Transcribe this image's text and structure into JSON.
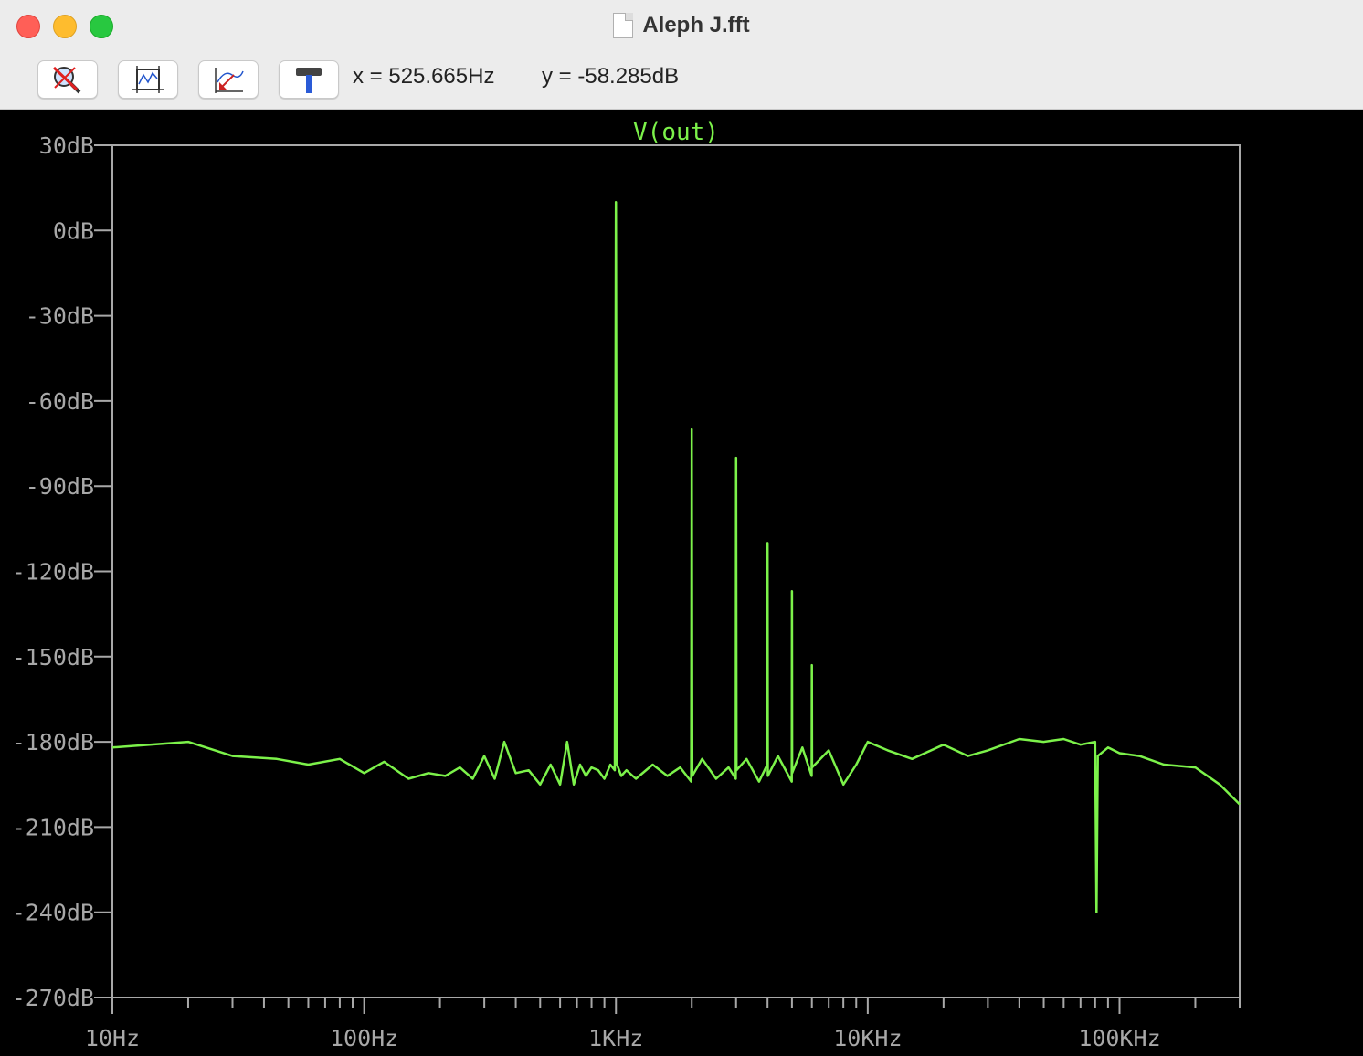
{
  "window": {
    "title": "Aleph J.fft"
  },
  "toolbar": {
    "buttons": [
      {
        "name": "zoom-cancel",
        "icon": "zoom-cancel-icon"
      },
      {
        "name": "autorange",
        "icon": "autorange-icon"
      },
      {
        "name": "pick-trace",
        "icon": "pick-trace-icon"
      },
      {
        "name": "hammer",
        "icon": "hammer-icon"
      }
    ],
    "cursor_x": "x = 525.665Hz",
    "cursor_y": "y = -58.285dB"
  },
  "colors": {
    "trace": "#7cf24a",
    "axis": "#a8a8a8",
    "background": "#000000"
  },
  "chart_data": {
    "type": "line",
    "title": "V(out)",
    "x_scale": "log",
    "xlim": [
      10,
      300000
    ],
    "ylim": [
      -270,
      30
    ],
    "xticks": [
      {
        "value": 10,
        "label": "10Hz"
      },
      {
        "value": 100,
        "label": "100Hz"
      },
      {
        "value": 1000,
        "label": "1KHz"
      },
      {
        "value": 10000,
        "label": "10KHz"
      },
      {
        "value": 100000,
        "label": "100KHz"
      }
    ],
    "yticks": [
      {
        "value": 30,
        "label": "30dB"
      },
      {
        "value": 0,
        "label": "0dB"
      },
      {
        "value": -30,
        "label": "-30dB"
      },
      {
        "value": -60,
        "label": "-60dB"
      },
      {
        "value": -90,
        "label": "-90dB"
      },
      {
        "value": -120,
        "label": "-120dB"
      },
      {
        "value": -150,
        "label": "-150dB"
      },
      {
        "value": -180,
        "label": "-180dB"
      },
      {
        "value": -210,
        "label": "-210dB"
      },
      {
        "value": -240,
        "label": "-240dB"
      },
      {
        "value": -270,
        "label": "-270dB"
      }
    ],
    "series": [
      {
        "name": "V(out)",
        "x": [
          10,
          20,
          30,
          45,
          60,
          80,
          100,
          120,
          150,
          180,
          210,
          240,
          270,
          300,
          330,
          360,
          400,
          450,
          500,
          550,
          600,
          640,
          680,
          720,
          760,
          800,
          850,
          900,
          950,
          990,
          1000,
          1010,
          1050,
          1100,
          1200,
          1400,
          1600,
          1800,
          1990,
          2000,
          2010,
          2200,
          2500,
          2800,
          2990,
          3000,
          3010,
          3300,
          3700,
          3990,
          4000,
          4010,
          4400,
          4990,
          5000,
          5010,
          5500,
          5990,
          6000,
          6010,
          7000,
          8000,
          9000,
          10000,
          12000,
          15000,
          20000,
          25000,
          30000,
          40000,
          50000,
          60000,
          70000,
          80000,
          81000,
          82000,
          90000,
          100000,
          120000,
          150000,
          200000,
          250000,
          300000
        ],
        "y": [
          -182,
          -180,
          -185,
          -186,
          -188,
          -186,
          -191,
          -187,
          -193,
          -191,
          -192,
          -189,
          -193,
          -185,
          -193,
          -180,
          -191,
          -190,
          -195,
          -188,
          -195,
          -180,
          -195,
          -188,
          -192,
          -189,
          -190,
          -193,
          -188,
          -190,
          10,
          -188,
          -192,
          -190,
          -193,
          -188,
          -192,
          -189,
          -194,
          -70,
          -192,
          -186,
          -193,
          -189,
          -193,
          -80,
          -190,
          -186,
          -194,
          -188,
          -110,
          -192,
          -185,
          -194,
          -127,
          -191,
          -182,
          -192,
          -153,
          -189,
          -183,
          -195,
          -188,
          -180,
          -183,
          -186,
          -181,
          -185,
          -183,
          -179,
          -180,
          -179,
          -181,
          -180,
          -240,
          -185,
          -182,
          -184,
          -185,
          -188,
          -189,
          -195,
          -202
        ]
      }
    ]
  }
}
